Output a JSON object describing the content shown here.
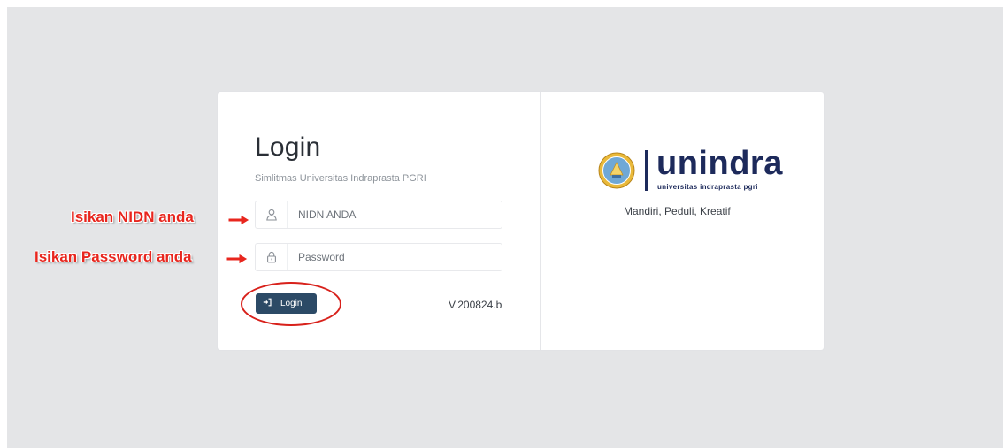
{
  "login": {
    "title": "Login",
    "subtitle": "Simlitmas Universitas Indraprasta PGRI",
    "nidn_placeholder": "NIDN ANDA",
    "password_placeholder": "Password",
    "button_label": "Login",
    "version": "V.200824.b"
  },
  "brand": {
    "logo_word": "unindra",
    "logo_subtitle": "universitas indraprasta pgri",
    "tagline": "Mandiri, Peduli, Kreatif"
  },
  "annotations": {
    "nidn_hint": "Isikan NIDN anda",
    "password_hint": "Isikan Password anda"
  },
  "icons": {
    "user_field": "user-icon",
    "password_field": "lock-icon",
    "login_button": "sign-in-icon",
    "university_seal": "seal-icon"
  },
  "colors": {
    "background": "#e4e5e7",
    "card": "#ffffff",
    "button": "#2c4a66",
    "brand_navy": "#1d2a5b",
    "annotation_red": "#e8261e"
  }
}
